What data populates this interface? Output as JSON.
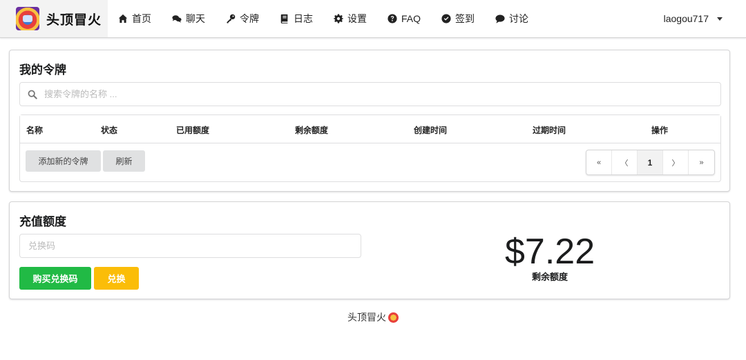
{
  "brand": {
    "name": "头顶冒火"
  },
  "nav": {
    "items": [
      {
        "label": "首页",
        "icon": "home-icon"
      },
      {
        "label": "聊天",
        "icon": "comments-icon"
      },
      {
        "label": "令牌",
        "icon": "key-icon"
      },
      {
        "label": "日志",
        "icon": "book-icon"
      },
      {
        "label": "设置",
        "icon": "gear-icon"
      },
      {
        "label": "FAQ",
        "icon": "question-circle-icon"
      },
      {
        "label": "签到",
        "icon": "check-circle-icon"
      },
      {
        "label": "讨论",
        "icon": "comment-icon"
      }
    ],
    "user": "laogou717"
  },
  "tokens": {
    "title": "我的令牌",
    "search_placeholder": "搜索令牌的名称 ...",
    "columns": [
      "名称",
      "状态",
      "已用额度",
      "剩余额度",
      "创建时间",
      "过期时间",
      "操作"
    ],
    "add_button": "添加新的令牌",
    "refresh_button": "刷新",
    "pagination": {
      "first": "«",
      "prev": "〈",
      "current": "1",
      "next": "〉",
      "last": "»"
    }
  },
  "topup": {
    "title": "充值额度",
    "redeem_placeholder": "兑换码",
    "buy_button": "购买兑换码",
    "redeem_button": "兑换",
    "balance": "$7.22",
    "balance_label": "剩余额度"
  },
  "footer": {
    "text": "头顶冒火"
  },
  "colors": {
    "accent_green": "#21ba45",
    "accent_yellow": "#fbbd08",
    "button_grey": "#e0e1e2"
  }
}
